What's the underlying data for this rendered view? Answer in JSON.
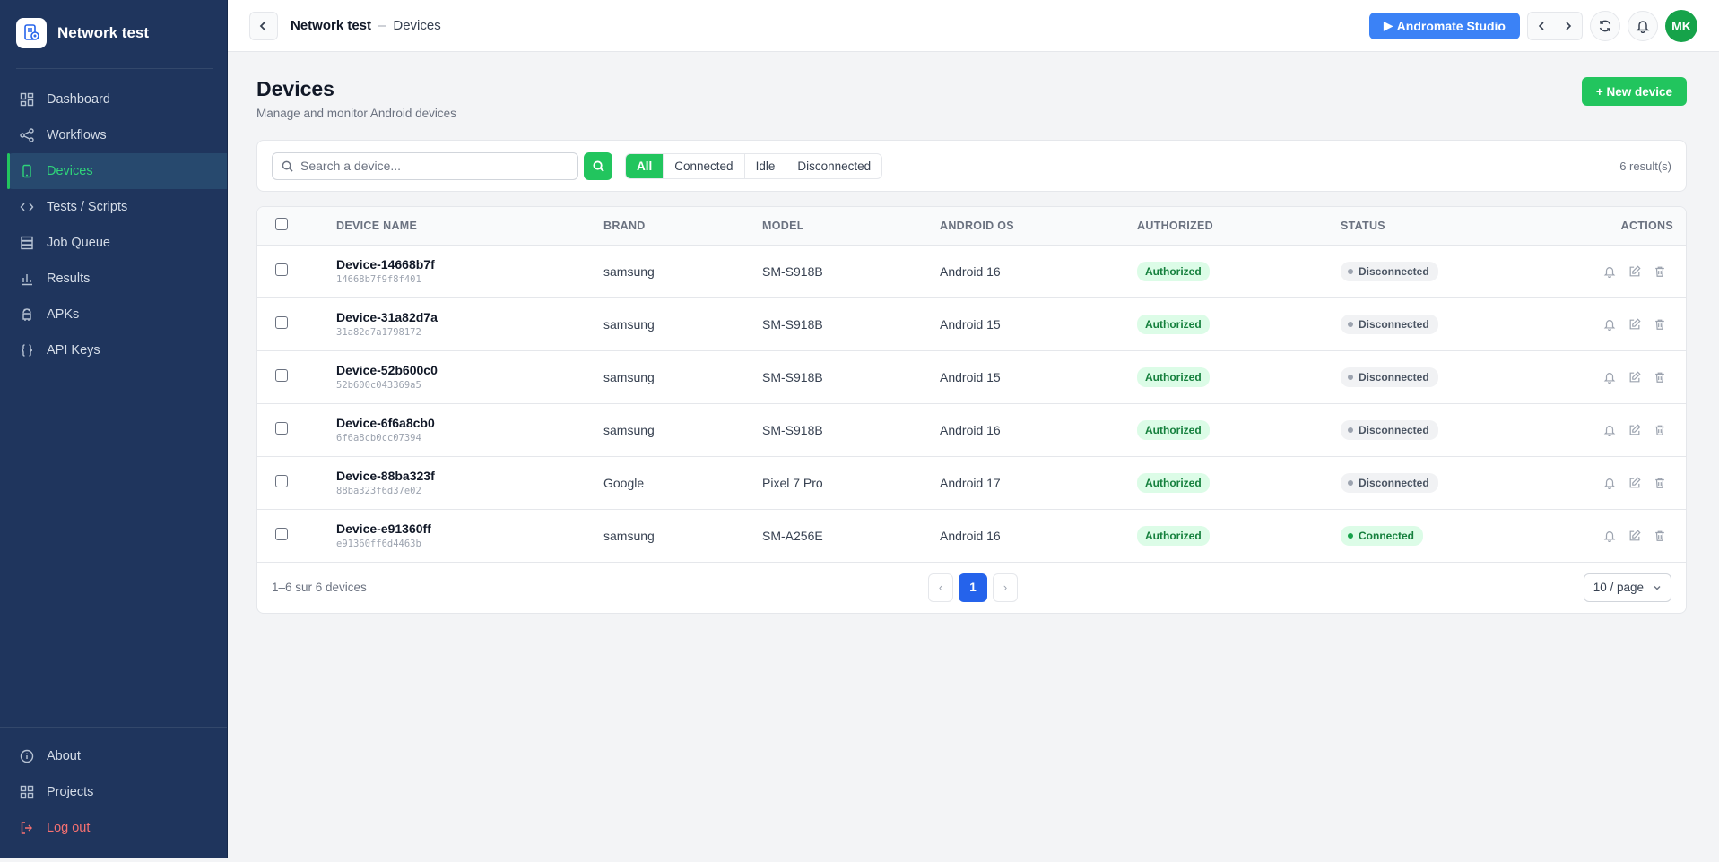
{
  "sidebar": {
    "brand": "Network test",
    "items": [
      {
        "label": "Dashboard",
        "icon": "dashboard-icon"
      },
      {
        "label": "Workflows",
        "icon": "workflow-icon"
      },
      {
        "label": "Devices",
        "icon": "phone-icon",
        "active": true
      },
      {
        "label": "Tests / Scripts",
        "icon": "code-icon"
      },
      {
        "label": "Job Queue",
        "icon": "queue-icon"
      },
      {
        "label": "Results",
        "icon": "chart-icon"
      },
      {
        "label": "APKs",
        "icon": "android-icon"
      },
      {
        "label": "API Keys",
        "icon": "braces-icon"
      }
    ],
    "bottom": [
      {
        "label": "About",
        "icon": "info-icon"
      },
      {
        "label": "Projects",
        "icon": "grid-icon"
      },
      {
        "label": "Log out",
        "icon": "logout-icon"
      }
    ]
  },
  "topbar": {
    "project": "Network test",
    "separator": "–",
    "page": "Devices",
    "studio_label": "Andromate Studio",
    "avatar": "MK"
  },
  "page": {
    "title": "Devices",
    "subtitle": "Manage and monitor Android devices",
    "new_button": "+ New device"
  },
  "filters": {
    "search_placeholder": "Search a device...",
    "segments": [
      "All",
      "Connected",
      "Idle",
      "Disconnected"
    ],
    "active_segment": "All",
    "result_count": "6 result(s)"
  },
  "table": {
    "headers": {
      "name": "DEVICE NAME",
      "brand": "BRAND",
      "model": "MODEL",
      "os": "ANDROID OS",
      "authorized": "AUTHORIZED",
      "status": "STATUS",
      "actions": "ACTIONS"
    },
    "rows": [
      {
        "name": "Device-14668b7f",
        "id": "14668b7f9f8f401",
        "brand": "samsung",
        "model": "SM-S918B",
        "os": "Android 16",
        "authorized": "Authorized",
        "status": "Disconnected"
      },
      {
        "name": "Device-31a82d7a",
        "id": "31a82d7a1798172",
        "brand": "samsung",
        "model": "SM-S918B",
        "os": "Android 15",
        "authorized": "Authorized",
        "status": "Disconnected"
      },
      {
        "name": "Device-52b600c0",
        "id": "52b600c043369a5",
        "brand": "samsung",
        "model": "SM-S918B",
        "os": "Android 15",
        "authorized": "Authorized",
        "status": "Disconnected"
      },
      {
        "name": "Device-6f6a8cb0",
        "id": "6f6a8cb0cc07394",
        "brand": "samsung",
        "model": "SM-S918B",
        "os": "Android 16",
        "authorized": "Authorized",
        "status": "Disconnected"
      },
      {
        "name": "Device-88ba323f",
        "id": "88ba323f6d37e02",
        "brand": "Google",
        "model": "Pixel 7 Pro",
        "os": "Android 17",
        "authorized": "Authorized",
        "status": "Disconnected"
      },
      {
        "name": "Device-e91360ff",
        "id": "e91360ff6d4463b",
        "brand": "samsung",
        "model": "SM-A256E",
        "os": "Android 16",
        "authorized": "Authorized",
        "status": "Connected"
      }
    ]
  },
  "pagination": {
    "summary": "1–6 sur 6 devices",
    "current_page": "1",
    "per_page": "10 / page"
  },
  "colors": {
    "sidebar_bg": "#1f355d",
    "accent_green": "#22c55e",
    "primary_blue": "#3b82f6"
  }
}
